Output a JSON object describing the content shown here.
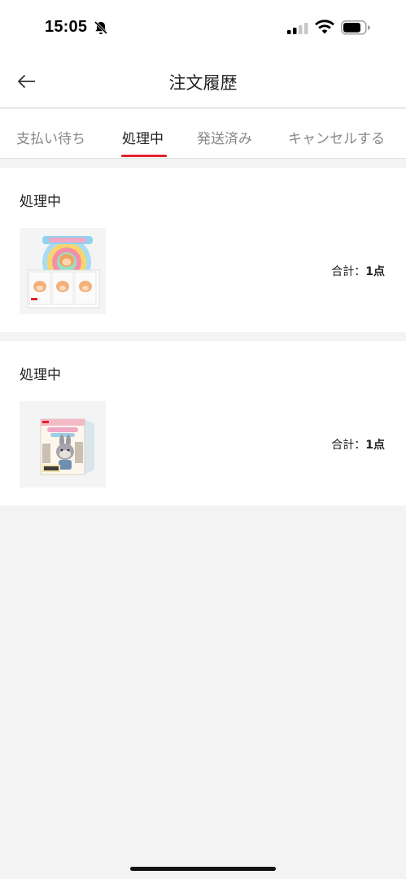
{
  "status_bar": {
    "time": "15:05"
  },
  "header": {
    "title": "注文履歴",
    "back_icon": "arrow-left-icon"
  },
  "tabs": [
    {
      "label": "支払い待ち",
      "active": false
    },
    {
      "label": "処理中",
      "active": true
    },
    {
      "label": "発送済み",
      "active": false
    },
    {
      "label": "キャンセルする",
      "active": false
    }
  ],
  "orders": [
    {
      "status": "処理中",
      "total_label": "合計：",
      "total_value": "1点"
    },
    {
      "status": "処理中",
      "total_label": "合計：",
      "total_value": "1点"
    }
  ],
  "colors": {
    "accent": "#e3242b",
    "background": "#f3f3f3",
    "card": "#ffffff",
    "inactive_tab": "#888888"
  }
}
